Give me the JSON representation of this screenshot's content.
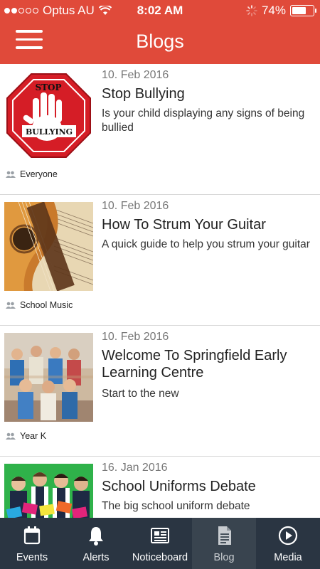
{
  "status_bar": {
    "carrier": "Optus AU",
    "time": "8:02 AM",
    "battery": "74%",
    "battery_level": 0.74
  },
  "header": {
    "title": "Blogs"
  },
  "posts": [
    {
      "date": "10. Feb 2016",
      "title": "Stop Bullying",
      "description": "Is your child displaying any signs of being bullied",
      "audience": "Everyone",
      "sign_top": "STOP",
      "sign_bottom": "BULLYING"
    },
    {
      "date": "10. Feb 2016",
      "title": "How To Strum Your Guitar",
      "description": "A quick guide to help you strum your guitar",
      "audience": "School Music"
    },
    {
      "date": "10. Feb 2016",
      "title": "Welcome To Springfield Early Learning Centre",
      "description": "Start to the new",
      "audience": "Year K"
    },
    {
      "date": "16. Jan 2016",
      "title": "School Uniforms Debate",
      "description": "The big school uniform debate",
      "audience": ""
    }
  ],
  "tabs": [
    {
      "label": "Events",
      "icon": "calendar-icon"
    },
    {
      "label": "Alerts",
      "icon": "bell-icon"
    },
    {
      "label": "Noticeboard",
      "icon": "newspaper-icon"
    },
    {
      "label": "Blog",
      "icon": "document-icon"
    },
    {
      "label": "Media",
      "icon": "play-icon"
    }
  ],
  "colors": {
    "header": "#e04a3a",
    "tabbar": "#2a3542",
    "tab_active": "#39444f"
  }
}
